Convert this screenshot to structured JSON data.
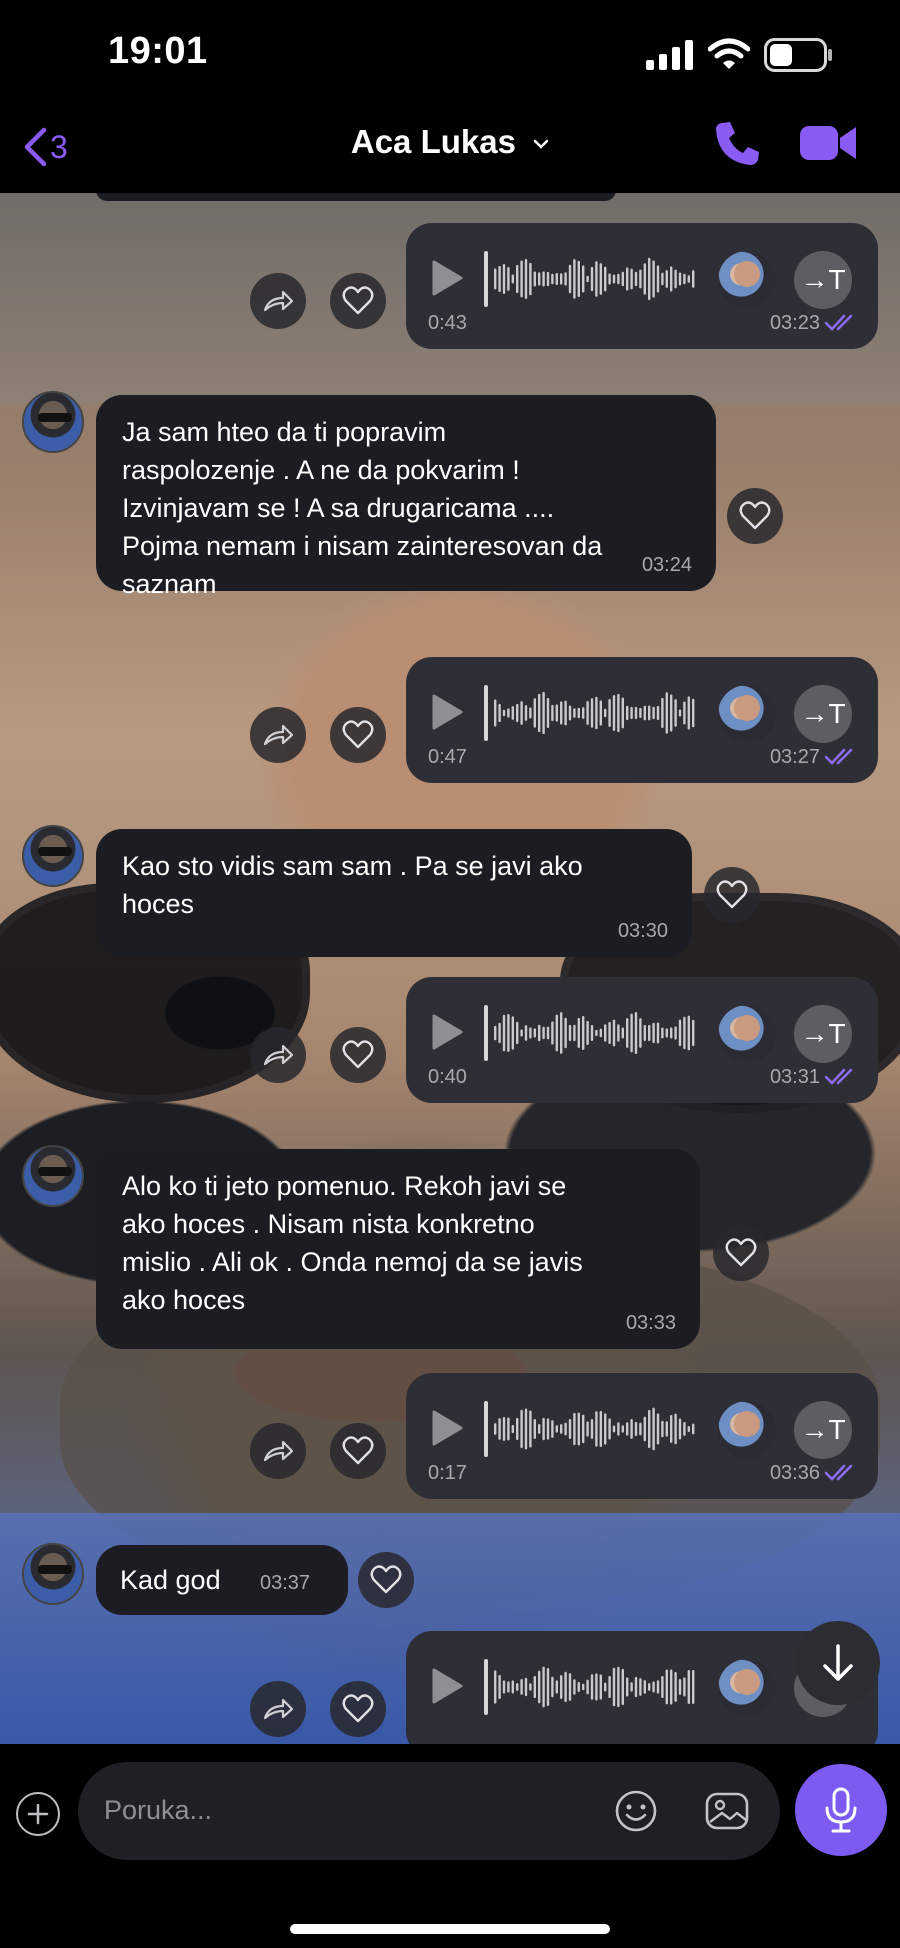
{
  "status_bar": {
    "time": "19:01"
  },
  "header": {
    "back_count": "3",
    "contact_name": "Aca Lukas"
  },
  "messages": [
    {
      "type": "voice",
      "direction": "out",
      "duration": "0:43",
      "time": "03:23"
    },
    {
      "type": "text",
      "direction": "in",
      "text": "Ja sam hteo da ti popravim\nraspolozenje . A ne da pokvarim !\nIzvinjavam se ! A sa drugaricama ....\nPojma nemam i nisam zainteresovan da\nsaznam",
      "time": "03:24"
    },
    {
      "type": "voice",
      "direction": "out",
      "duration": "0:47",
      "time": "03:27"
    },
    {
      "type": "text",
      "direction": "in",
      "text": "Kao sto vidis sam sam . Pa se javi ako\nhoces",
      "time": "03:30"
    },
    {
      "type": "voice",
      "direction": "out",
      "duration": "0:40",
      "time": "03:31"
    },
    {
      "type": "text",
      "direction": "in",
      "text": "Alo ko ti jeto pomenuo. Rekoh javi se\nako hoces . Nisam nista konkretno\nmislio . Ali ok . Onda nemoj da se javis\nako hoces",
      "time": "03:33"
    },
    {
      "type": "voice",
      "direction": "out",
      "duration": "0:17",
      "time": "03:36"
    },
    {
      "type": "text",
      "direction": "in",
      "text": "Kad god",
      "time": "03:37"
    },
    {
      "type": "voice",
      "direction": "out",
      "duration": "",
      "time": ""
    }
  ],
  "voice": {
    "transcribe_label": "→T"
  },
  "composer": {
    "placeholder": "Poruka..."
  },
  "icons": {
    "back": "chevron-left-icon",
    "call": "phone-icon",
    "video": "video-camera-icon",
    "forward": "forward-arrow-icon",
    "like": "heart-icon",
    "play": "play-icon",
    "add": "plus-icon",
    "sticker": "smiley-icon",
    "gallery": "gallery-icon",
    "mic": "microphone-icon",
    "scroll": "arrow-down-icon"
  },
  "colors": {
    "accent": "#7d5bf3",
    "incoming_bubble": "#1c1d22",
    "outgoing_bubble": "#2e2f36"
  }
}
